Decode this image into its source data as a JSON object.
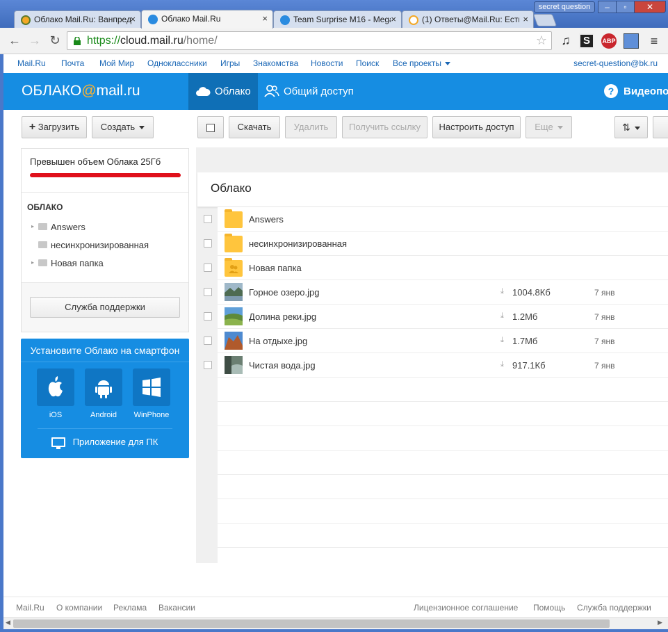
{
  "browser": {
    "tabs": [
      {
        "title": "Облако Mail.Ru: Ванпредс",
        "active": false
      },
      {
        "title": "Облако Mail.Ru",
        "active": true
      },
      {
        "title": "Team Surprise M16 - Mega",
        "active": false
      },
      {
        "title": "(1) Ответы@Mail.Ru: Есть",
        "active": false
      }
    ],
    "close_glyph": "×",
    "window_user": "secret question",
    "url_scheme": "https://",
    "url_host": "cloud.mail.ru",
    "url_path": "/home/",
    "extension_abp": "ABP"
  },
  "portal": {
    "links": [
      "Mail.Ru",
      "Почта",
      "Мой Мир",
      "Одноклассники",
      "Игры",
      "Знакомства",
      "Новости",
      "Поиск",
      "Все проекты"
    ],
    "user_email": "secret-question@bk.ru"
  },
  "header": {
    "logo_left": "ОБЛАКО",
    "logo_at": "@",
    "logo_right": "mail.ru",
    "nav_cloud": "Облако",
    "nav_share": "Общий доступ",
    "nav_video": "Видеопо"
  },
  "actions": {
    "upload": "Загрузить",
    "create": "Создать",
    "download": "Скачать",
    "delete": "Удалить",
    "get_link": "Получить ссылку",
    "access": "Настроить доступ",
    "more": "Еще"
  },
  "sidebar": {
    "quota_text": "Превышен объем Облака 25Гб",
    "quota_used_fraction": 1.0,
    "quota_color": "#e0101b",
    "tree_title": "ОБЛАКО",
    "tree": [
      "Answers",
      "несинхронизированная",
      "Новая папка"
    ],
    "support": "Служба поддержки"
  },
  "promo": {
    "title": "Установите Облако на смартфон",
    "apps": [
      "iOS",
      "Android",
      "WinPhone"
    ],
    "pc_app": "Приложение для ПК"
  },
  "main": {
    "title": "Облако",
    "items": [
      {
        "name": "Answers",
        "type": "folder",
        "size": "",
        "date": ""
      },
      {
        "name": "несинхронизированная",
        "type": "folder",
        "size": "",
        "date": ""
      },
      {
        "name": "Новая папка",
        "type": "shared-folder",
        "size": "",
        "date": ""
      },
      {
        "name": "Горное озеро.jpg",
        "type": "image",
        "size": "1004.8Кб",
        "date": "7 янв"
      },
      {
        "name": "Долина реки.jpg",
        "type": "image",
        "size": "1.2Мб",
        "date": "7 янв"
      },
      {
        "name": "На отдыхе.jpg",
        "type": "image",
        "size": "1.7Мб",
        "date": "7 янв"
      },
      {
        "name": "Чистая вода.jpg",
        "type": "image",
        "size": "917.1Кб",
        "date": "7 янв"
      }
    ]
  },
  "footer": {
    "left": [
      "Mail.Ru",
      "О компании",
      "Реклама",
      "Вакансии"
    ],
    "right": [
      "Лицензионное соглашение",
      "Помощь",
      "Служба поддержки"
    ]
  },
  "colors": {
    "brand_blue": "#168de2",
    "active_nav": "#0f6fb6",
    "folder": "#ffc53d",
    "link": "#1966b5"
  }
}
